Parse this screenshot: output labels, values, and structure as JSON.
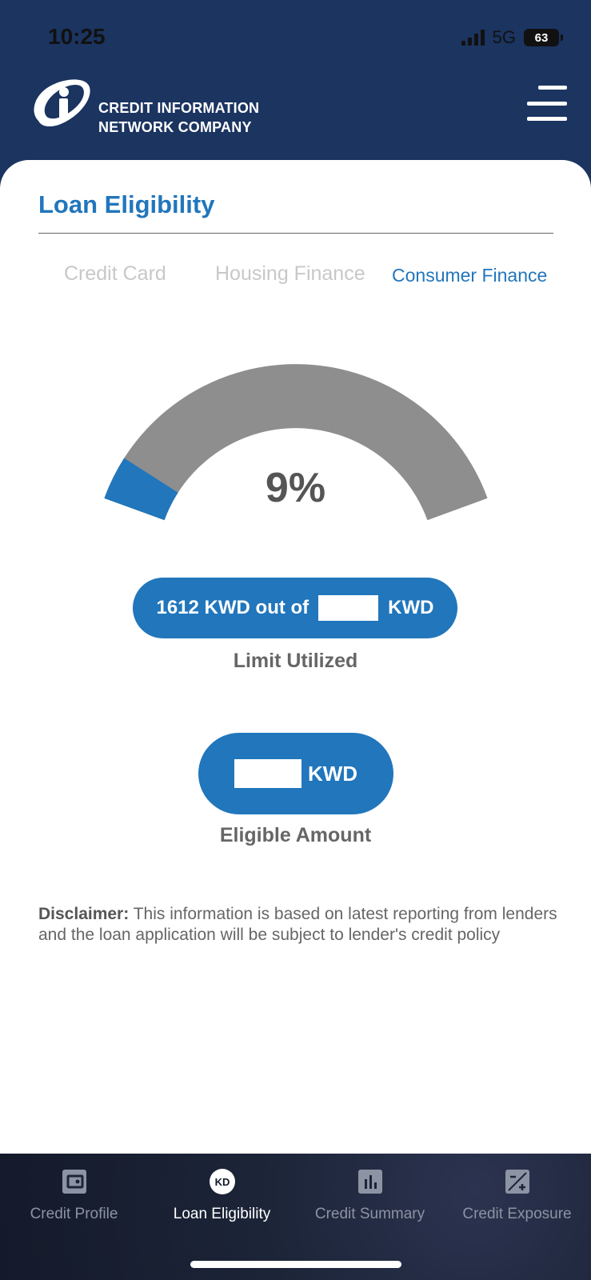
{
  "status_bar": {
    "time": "10:25",
    "network": "5G",
    "battery": "63"
  },
  "header": {
    "logo_line1": "CREDIT INFORMATION",
    "logo_line2": "NETWORK COMPANY"
  },
  "page": {
    "title": "Loan Eligibility"
  },
  "tabs": [
    {
      "label": "Credit Card",
      "active": false
    },
    {
      "label": "Housing Finance",
      "active": false
    },
    {
      "label": "Consumer Finance",
      "active": true
    }
  ],
  "gauge": {
    "percent_label": "9%",
    "fraction": 0.09,
    "fill_color": "#2176bc",
    "track_color": "#8e8e8e"
  },
  "limit": {
    "used_text": "1612 KWD out of",
    "unit": "KWD",
    "caption": "Limit Utilized"
  },
  "eligible": {
    "unit": "KWD",
    "caption": "Eligible Amount"
  },
  "disclaimer": {
    "label": "Disclaimer:",
    "text": " This information is based on latest reporting from lenders and the loan application will be subject to lender's credit policy"
  },
  "bottom_nav": [
    {
      "label": "Credit Profile",
      "icon": "wallet-icon",
      "active": false
    },
    {
      "label": "Loan Eligibility",
      "icon": "kd-coin-icon",
      "badge": "KD",
      "active": true
    },
    {
      "label": "Credit Summary",
      "icon": "bar-chart-icon",
      "active": false
    },
    {
      "label": "Credit Exposure",
      "icon": "plus-minus-icon",
      "active": false
    }
  ],
  "colors": {
    "brand_blue": "#2176bc",
    "header_navy": "#1b3460",
    "text_gray": "#666666"
  }
}
